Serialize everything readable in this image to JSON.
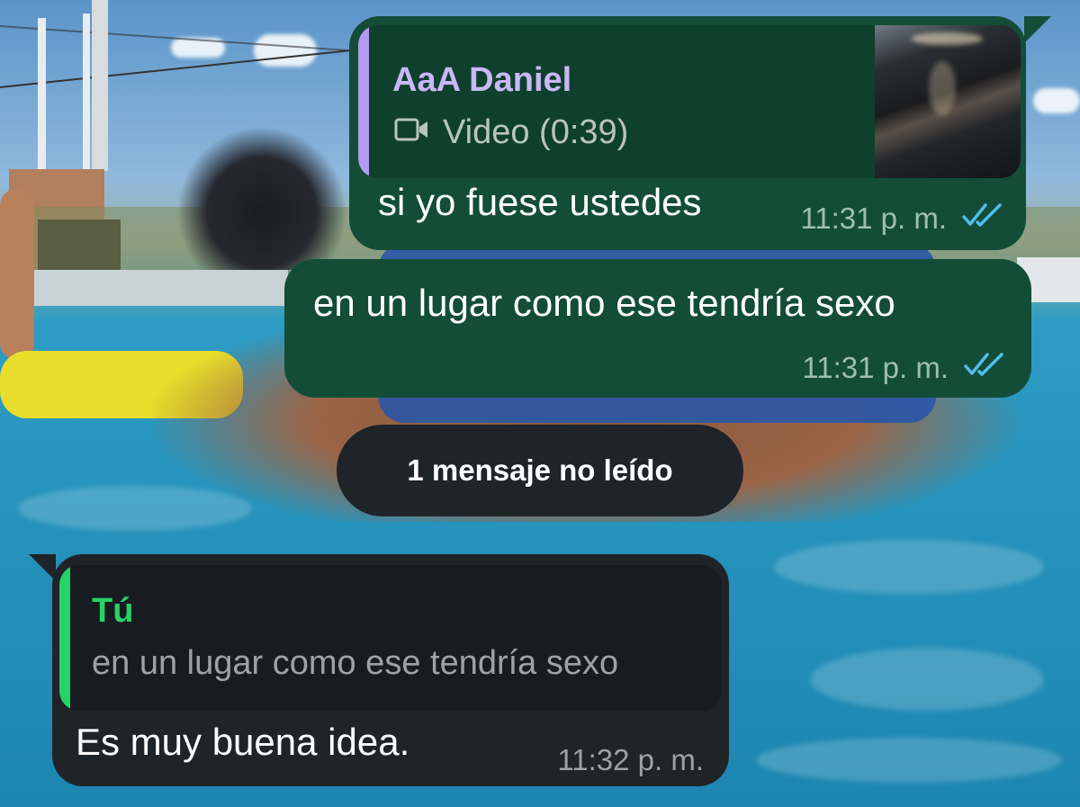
{
  "chat": {
    "messages": [
      {
        "direction": "outgoing",
        "quote": {
          "author": "AaA Daniel",
          "media_label": "Video (0:39)",
          "media_icon": "video-camera-icon"
        },
        "text": "si yo fuese ustedes",
        "time": "11:31 p. m.",
        "status": "read"
      },
      {
        "direction": "outgoing",
        "text": "en un lugar como ese tendría sexo",
        "time": "11:31 p. m.",
        "status": "read"
      },
      {
        "direction": "incoming",
        "quote": {
          "author": "Tú",
          "text": "en un lugar como ese tendría sexo"
        },
        "text": "Es muy buena idea.",
        "time": "11:32 p. m."
      }
    ],
    "unread_divider": "1 mensaje no leído"
  },
  "colors": {
    "outgoing_bubble": "#134d37",
    "incoming_bubble": "#1f2429",
    "quote_author_outgoing": "#c9b8f5",
    "quote_bar_outgoing": "#b49af0",
    "quote_author_incoming": "#25d366",
    "quote_bar_incoming": "#25d366",
    "read_ticks": "#53bdeb"
  }
}
